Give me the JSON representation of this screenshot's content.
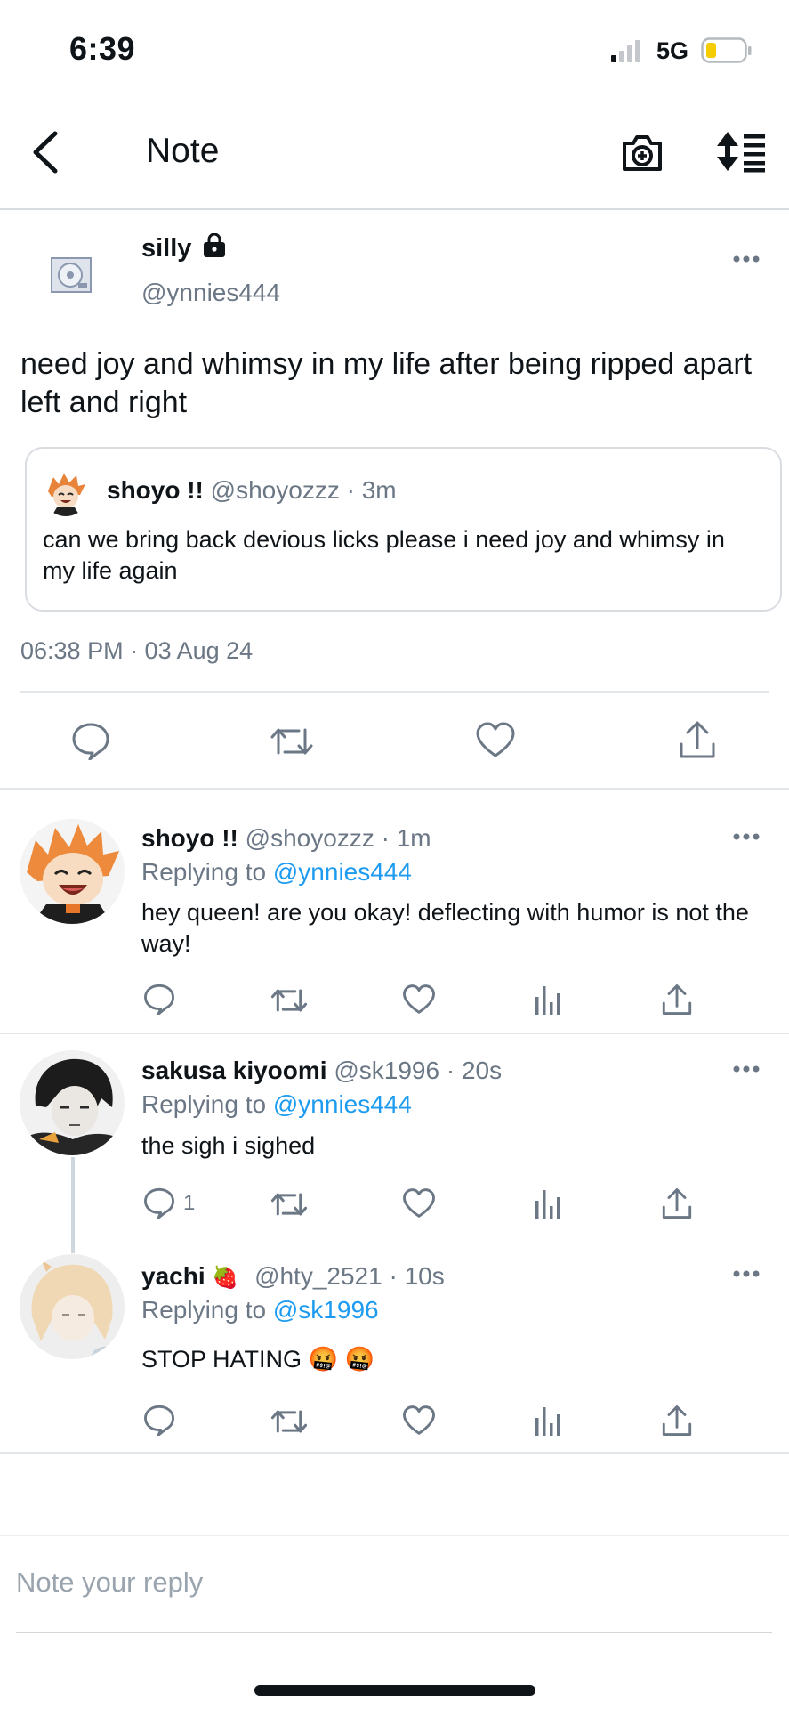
{
  "status_bar": {
    "time": "6:39",
    "network": "5G"
  },
  "header": {
    "title": "Note"
  },
  "main_tweet": {
    "author_name": "silly",
    "handle": "@ynnies444",
    "text": "need joy and whimsy in my life after being ripped apart left and right",
    "quote": {
      "author_name": "shoyo !!",
      "meta": "@shoyozzz · 3m",
      "text": "can we bring back devious licks please i need joy and whimsy in my life again"
    },
    "timestamp": "06:38 PM · 03 Aug 24"
  },
  "replies": [
    {
      "author_name": "shoyo !!",
      "meta": "@shoyozzz · 1m",
      "replying_prefix": "Replying to",
      "replying_to": "@ynnies444",
      "text": "hey queen! are you okay! deflecting with humor is not the way!",
      "reply_count": ""
    },
    {
      "author_name": "sakusa kiyoomi",
      "meta": "@sk1996 · 20s",
      "replying_prefix": "Replying to",
      "replying_to": "@ynnies444",
      "text": "the sigh i sighed",
      "reply_count": "1"
    },
    {
      "author_name": "yachi",
      "name_emoji": "🍓",
      "meta": "@hty_2521 · 10s",
      "replying_prefix": "Replying to",
      "replying_to": "@sk1996",
      "text": "STOP HATING 🤬 🤬",
      "reply_count": ""
    }
  ],
  "reply_box": {
    "placeholder": "Note your reply"
  },
  "colors": {
    "accent": "#1d9bf0",
    "text": "#0f1419",
    "secondary": "#6b7785",
    "divider": "#e4e7ea"
  }
}
